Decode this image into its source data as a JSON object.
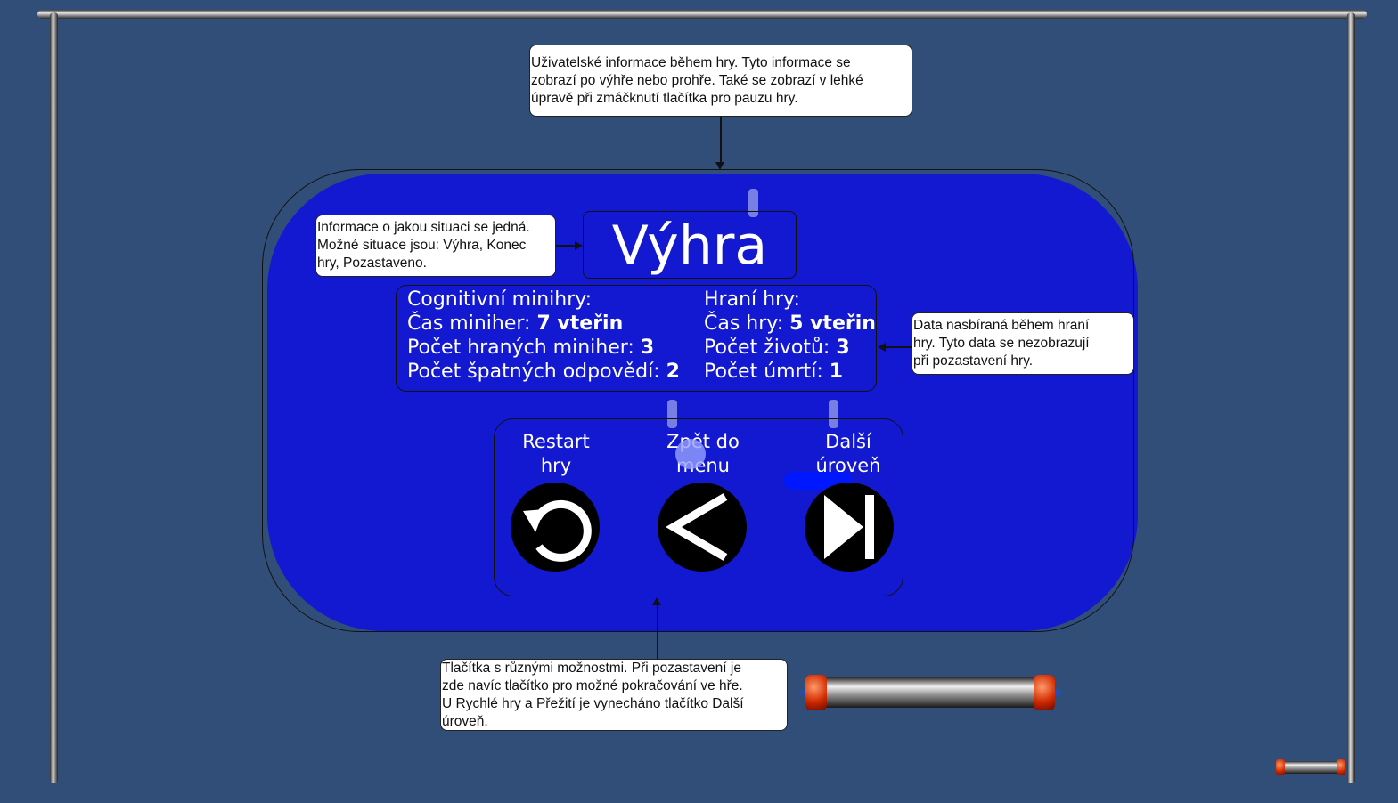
{
  "notes": {
    "top": [
      "Uživatelské informace během hry. Tyto informace se",
      "zobrazí po výhře nebo prohře. Také se zobrazí v lehké",
      "úpravě při zmáčknutí tlačítka pro pauzu hry."
    ],
    "left": [
      "Informace o jakou situaci se jedná.",
      "Možné situace jsou: Výhra, Konec",
      "hry, Pozastaveno."
    ],
    "right": [
      "Data nasbíraná během hraní",
      "hry. Tyto data se nezobrazují",
      "při pozastavení hry."
    ],
    "bottom": [
      "Tlačítka s různými možnostmi. Při pozastavení je",
      "zde navíc tlačítko pro možné pokračování ve hře.",
      "U Rychlé hry a Přežití je vynecháno tlačítko Další",
      "úroveň."
    ]
  },
  "screen": {
    "title": "Výhra",
    "minigames": {
      "heading": "Cognitivní minihry:",
      "time_label": "Čas miniher:",
      "time_value": "7 vteřin",
      "played_label": "Počet hraných miniher:",
      "played_value": "3",
      "wrong_label": "Počet špatných odpovědí:",
      "wrong_value": "2"
    },
    "game": {
      "heading": "Hraní hry:",
      "time_label": "Čas hry:",
      "time_value": "5 vteřin",
      "lives_label": "Počet životů:",
      "lives_value": "3",
      "deaths_label": "Počet úmrtí:",
      "deaths_value": "1"
    },
    "buttons": {
      "restart": [
        "Restart",
        "hry"
      ],
      "menu": [
        "Zpět do",
        "menu"
      ],
      "next": [
        "Další",
        "úroveň"
      ]
    }
  },
  "icons": [
    "restart-icon",
    "back-arrow-icon",
    "skip-next-icon"
  ],
  "colors": {
    "background": "#314e78",
    "panel": "#1319d0"
  }
}
